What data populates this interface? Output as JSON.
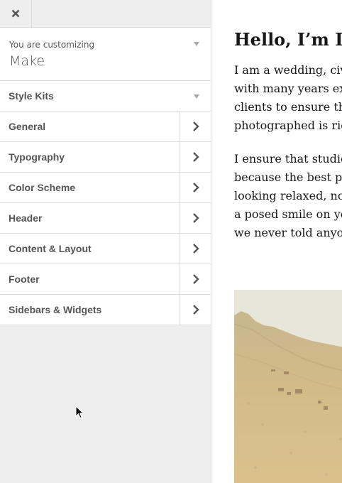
{
  "sidebar": {
    "info": {
      "label": "You are customizing",
      "theme_name": "Make"
    },
    "style_kits_label": "Style Kits",
    "items": [
      {
        "label": "General"
      },
      {
        "label": "Typography"
      },
      {
        "label": "Color Scheme"
      },
      {
        "label": "Header"
      },
      {
        "label": "Content & Layout"
      },
      {
        "label": "Footer"
      },
      {
        "label": "Sidebars & Widgets"
      }
    ]
  },
  "preview": {
    "heading": "Hello, I’m D",
    "paragraph1": [
      "I am a wedding, civil",
      "with many years exp",
      "clients to ensure tha",
      "photographed is righ"
    ],
    "paragraph2": [
      "I ensure that studio ",
      "because the best pho",
      "looking relaxed, not ",
      "a posed smile on you",
      "we never told anyone"
    ]
  },
  "colors": {
    "sidebar_bg": "#eeeeee",
    "panel_bg": "#ffffff",
    "border": "#dddddd",
    "text": "#555555",
    "preview_text": "#171717"
  },
  "icons": {
    "close": "close-icon",
    "caret": "caret-down-icon",
    "chevron": "chevron-right-icon",
    "cursor": "mouse-cursor-icon"
  }
}
